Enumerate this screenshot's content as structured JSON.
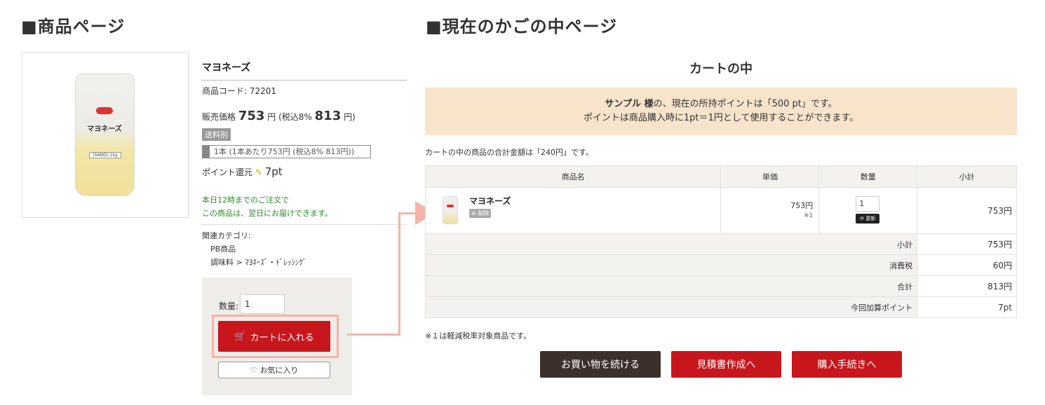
{
  "headings": {
    "left": "■商品ページ",
    "right": "■現在のかごの中ページ"
  },
  "product": {
    "image_label": "マヨネーズ",
    "image_sub": "(SAMD) 1kg",
    "name": "マヨネーズ",
    "code_label": "商品コード: 72201",
    "price_label": "販売価格",
    "price": "753",
    "yen": "円",
    "tax_label": "(税込8%",
    "tax_price": "813",
    "tax_yen": "円)",
    "free_shipping": "送料別",
    "unit_text": "1本 (1本あたり753円 (税込8% 813円))",
    "points_label": "ポイント還元",
    "points_icon": "pencil-icon",
    "points_value": "7pt",
    "delivery_line1": "本日12時までのご注文で",
    "delivery_line2": "この商品は、翌日にお届けできます。",
    "categories_label": "関連カテゴリ:",
    "category_1": "PB商品",
    "category_2": "調味料 > ﾏﾖﾈｰｽﾞ・ﾄﾞﾚｯｼﾝｸﾞ",
    "qty_label": "数量:",
    "qty_value": "1",
    "add_cart": "カートに入れる",
    "favorite": "お気に入り"
  },
  "cart": {
    "title": "カートの中",
    "banner_name": "サンプル 様",
    "banner_line1_rest": "の、現在の所持ポイントは「500 pt」です。",
    "banner_line2": "ポイントは商品購入時に1pt＝1円として使用することができます。",
    "total_message": "カートの中の商品の合計金額は「240円」です。",
    "headers": {
      "name": "商品名",
      "price": "単価",
      "qty": "数量",
      "subtotal": "小計"
    },
    "item": {
      "name": "マヨネーズ",
      "delete": "削除",
      "price": "753円",
      "note": "※1",
      "qty": "1",
      "update": "更新",
      "subtotal": "753円"
    },
    "summary": [
      {
        "label": "小計",
        "value": "753円"
      },
      {
        "label": "消費税",
        "value": "60円"
      },
      {
        "label": "合計",
        "value": "813円"
      },
      {
        "label": "今回加算ポイント",
        "value": "7pt"
      }
    ],
    "footnote": "※１は軽減税率対象商品です。",
    "buttons": {
      "continue": "お買い物を続ける",
      "quote": "見積書作成へ",
      "checkout": "購入手続きへ"
    }
  },
  "colors": {
    "accent_red": "#c8161d",
    "dark_button": "#3d302b",
    "banner_bg": "#f8e3cb",
    "highlight": "#f4b3a8",
    "delivery_green": "#2a8a2a"
  }
}
